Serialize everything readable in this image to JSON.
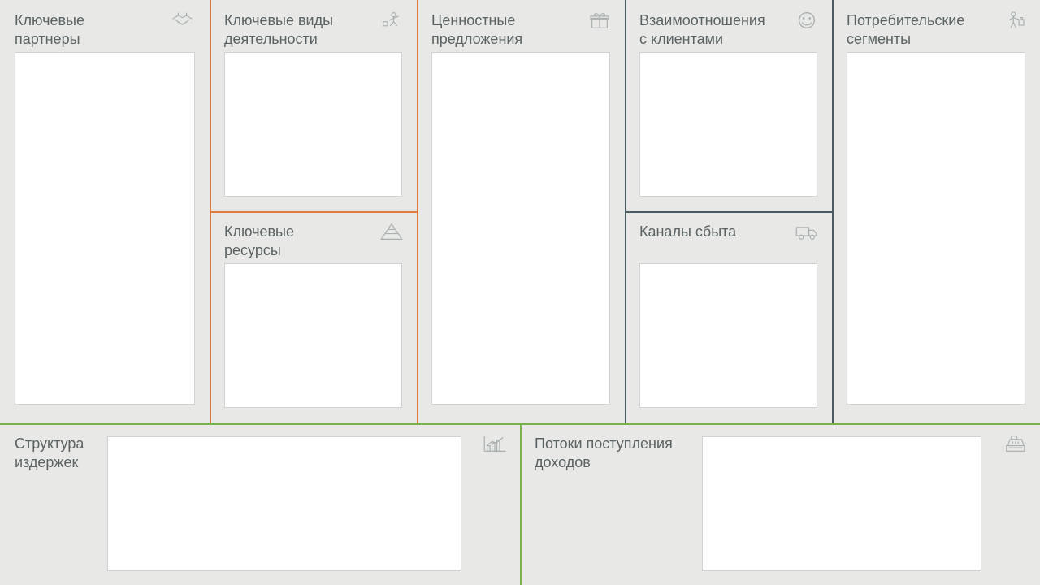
{
  "blocks": {
    "partners": {
      "title": "Ключевые партнеры"
    },
    "activities": {
      "title": "Ключевые виды деятельности"
    },
    "resources": {
      "title": "Ключевые ресурсы"
    },
    "value": {
      "title": "Ценностные предложения"
    },
    "relations": {
      "title": "Взаимоотношения с клиентами"
    },
    "channels": {
      "title": "Каналы сбыта"
    },
    "segments": {
      "title": "Потребительские сегменты"
    },
    "costs": {
      "title": "Структура издержек"
    },
    "revenue": {
      "title": "Потоки поступления доходов"
    }
  },
  "colors": {
    "orange": "#e07a3f",
    "slate": "#4b5a60",
    "green": "#79b24a",
    "bg": "#e8e9e7",
    "ink": "#5a6263",
    "icon": "#a9b0af"
  }
}
